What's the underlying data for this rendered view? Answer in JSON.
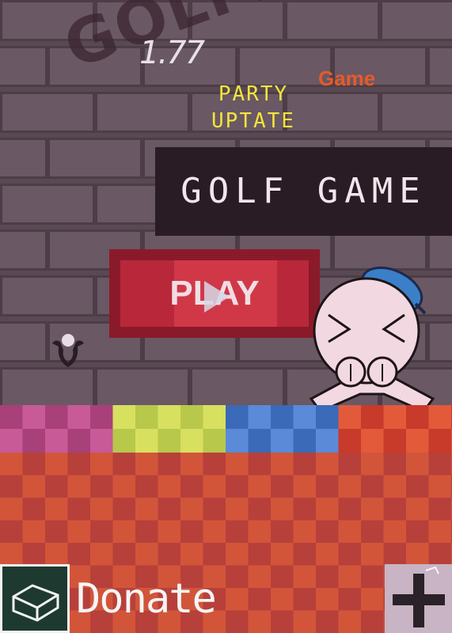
{
  "title": {
    "logo_text": "GOLFLEV",
    "version": "1.77",
    "game_tag": "Game",
    "party_line1": "PARTY",
    "party_line2": "UPTATE"
  },
  "banner": {
    "label": "GOLF GAME"
  },
  "play_button": {
    "label": "PLAY",
    "icon": "play-triangle-icon"
  },
  "bottom_bar": {
    "donate_label": "Donate",
    "left_icon": "box-icon",
    "right_icon": "plus-icon"
  },
  "colors": {
    "wall": "#594953",
    "brick": "#6a5864",
    "panel_dark": "#2a1c24",
    "play_red": "#b8283a",
    "title_yellow": "#f1e63a",
    "tag_orange": "#e65a2a",
    "mascot_hat": "#3a7fc8",
    "mascot_body": "#f2d8e0",
    "floor_a": "#d2553a",
    "floor_b": "#b8403a"
  },
  "strip_palette": [
    [
      "#a8407a",
      "#c85a98"
    ],
    [
      "#b8c84a",
      "#d8e060"
    ],
    [
      "#3a6ab8",
      "#5a8ad8"
    ],
    [
      "#c83a2a",
      "#e25a3a"
    ]
  ]
}
